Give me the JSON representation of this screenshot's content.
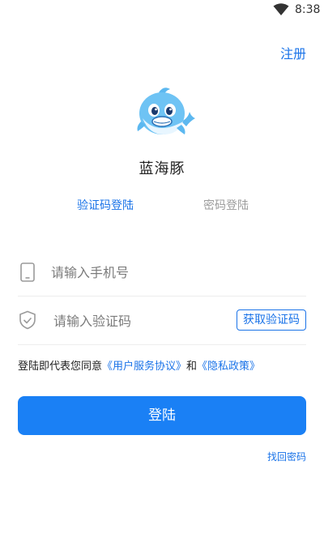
{
  "status_bar": {
    "time": "8:38",
    "wifi_icon": "wifi-icon"
  },
  "header": {
    "register_label": "注册"
  },
  "brand": {
    "logo_icon": "dolphin-logo-icon",
    "app_name": "蓝海豚"
  },
  "tabs": [
    {
      "label": "验证码登陆",
      "active": true
    },
    {
      "label": "密码登陆",
      "active": false
    }
  ],
  "phone_field": {
    "icon": "phone-icon",
    "placeholder": "请输入手机号",
    "value": ""
  },
  "code_field": {
    "icon": "shield-icon",
    "placeholder": "请输入验证码",
    "value": "",
    "get_code_label": "获取验证码"
  },
  "agreement": {
    "prefix": "登陆即代表您同意",
    "user_agreement": "《用户服务协议》",
    "conjunction": "和",
    "privacy_policy": "《隐私政策》"
  },
  "login_button": {
    "label": "登陆"
  },
  "forgot_password": {
    "label": "找回密码"
  },
  "colors": {
    "accent": "#1a73e8",
    "button": "#1a80f5",
    "logo_blue": "#5cb8f0"
  }
}
